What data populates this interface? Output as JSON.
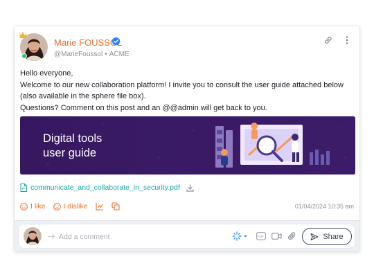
{
  "post": {
    "author_name": "Marie FOUSSOL",
    "author_handle": "@MarieFoussol",
    "author_org": "ACME",
    "text_lines": [
      "Hello everyone,",
      "Welcome to our new collaboration platform! I invite you to consult the user guide attached below (also available in the sphere file box).",
      "Questions? Comment on this post and an @@admin will get back to you."
    ],
    "banner_title_line1": "Digital tools",
    "banner_title_line2": "user guide",
    "attachment_name": "communicate_and_collaborate_in_security.pdf",
    "like_label": "I like",
    "dislike_label": "I dislike",
    "timestamp": "01/04/2024 10:35 am"
  },
  "comment": {
    "placeholder": "Add a comment",
    "share_label": "Share"
  },
  "colors": {
    "accent": "#e8702a",
    "link": "#17a3a7",
    "banner_bg": "#3a1a63",
    "verified": "#2d7ff9",
    "online": "#2ec26b"
  },
  "icons": [
    "crown-icon",
    "verified-icon",
    "link-icon",
    "more-vertical-icon",
    "pdf-icon",
    "download-icon",
    "smile-icon",
    "frown-icon",
    "chart-icon",
    "copy-icon",
    "arrow-icon",
    "sparkle-icon",
    "gif-icon",
    "video-icon",
    "paperclip-icon",
    "send-icon"
  ]
}
